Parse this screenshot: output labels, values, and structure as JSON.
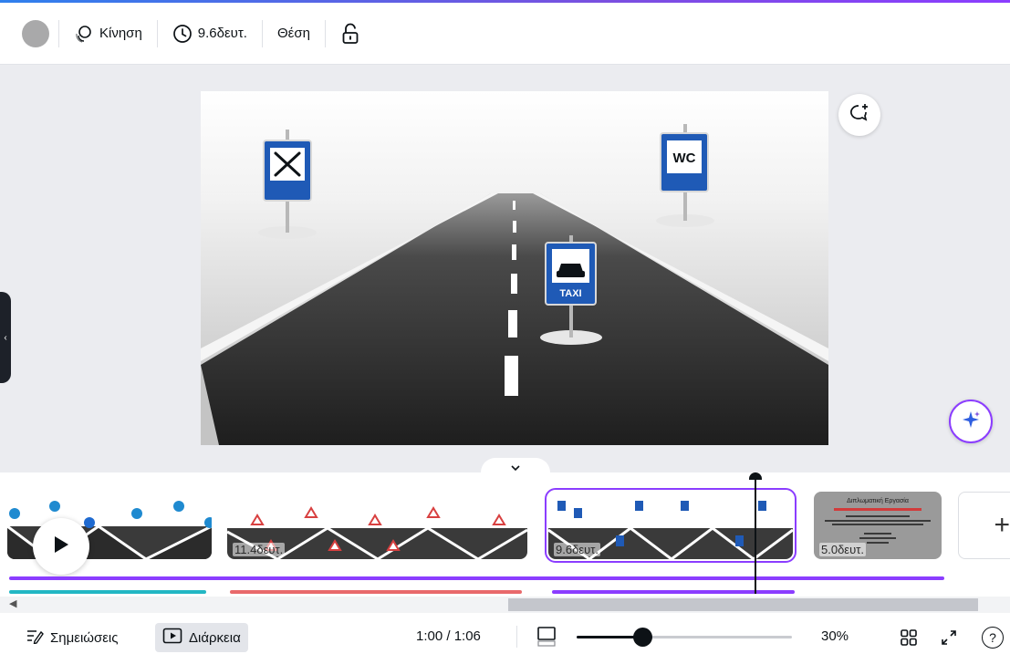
{
  "toolbar": {
    "animate_label": "Κίνηση",
    "duration_label": "9.6δευτ.",
    "position_label": "Θέση"
  },
  "slide": {
    "signs": [
      {
        "icon": "restaurant-icon"
      },
      {
        "icon": "wc-icon",
        "text": "WC"
      },
      {
        "icon": "taxi-icon",
        "text": "TAXI"
      }
    ]
  },
  "timeline": {
    "clips": [
      {
        "duration": ""
      },
      {
        "duration": "11.4δευτ."
      },
      {
        "duration": "9.6δευτ.",
        "selected": true
      },
      {
        "duration": "5.0δευτ."
      }
    ],
    "clip4_heading": "Διπλωματική Εργασία",
    "add_label": "+"
  },
  "footer": {
    "notes_label": "Σημειώσεις",
    "duration_label": "Διάρκεια",
    "time": "1:00 / 1:06",
    "zoom": "30%",
    "zoom_level": 0.3,
    "help": "?"
  },
  "colors": {
    "accent_purple": "#8b3dff",
    "track_teal": "#23b7c4",
    "track_red": "#e8696b",
    "sign_blue": "#1f5ab6"
  }
}
